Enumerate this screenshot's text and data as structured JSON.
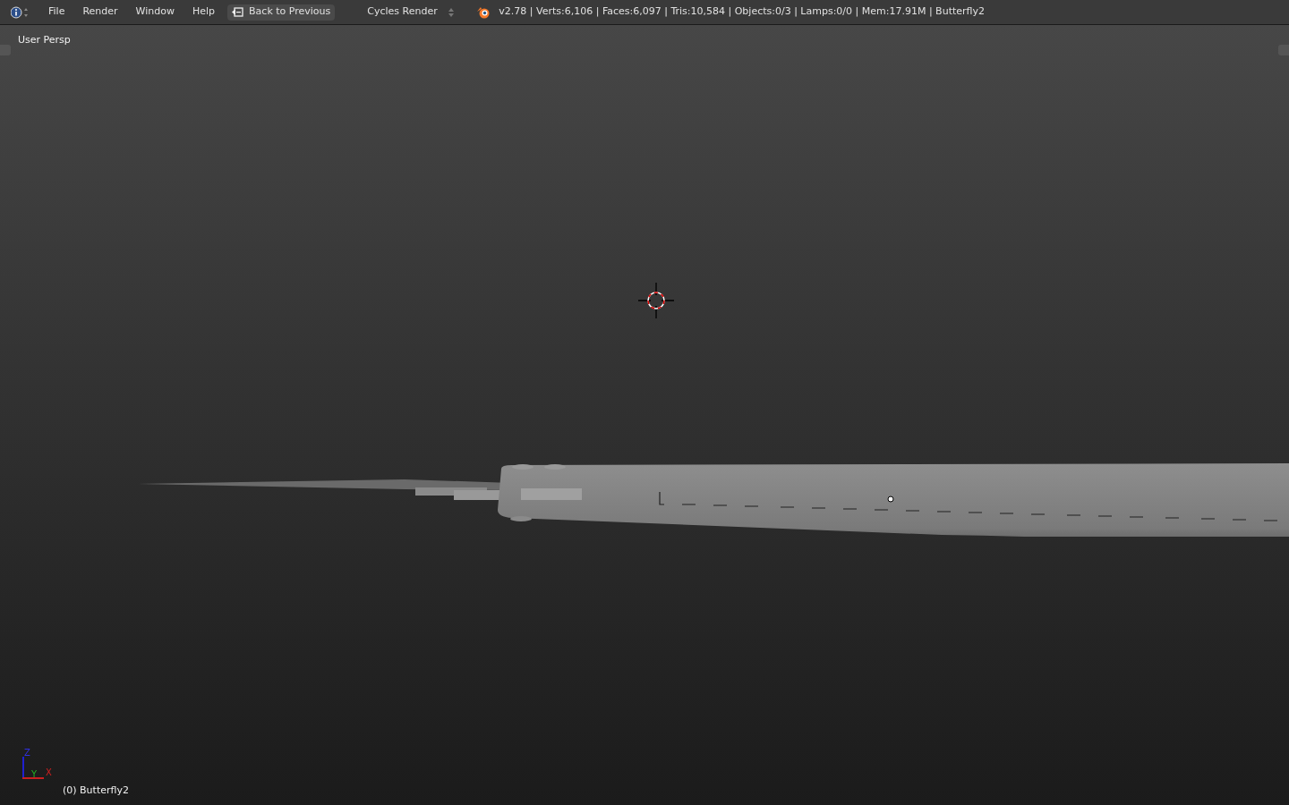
{
  "header": {
    "menus": [
      "File",
      "Render",
      "Window",
      "Help"
    ],
    "back_button": "Back to Previous",
    "render_engine": "Cycles Render",
    "stats": "v2.78 | Verts:6,106 | Faces:6,097 | Tris:10,584 | Objects:0/3 | Lamps:0/0 | Mem:17.91M | Butterfly2"
  },
  "viewport": {
    "view_label": "User Persp",
    "object_label": "(0) Butterfly2",
    "axes": [
      "Z",
      "Y",
      "X"
    ]
  }
}
